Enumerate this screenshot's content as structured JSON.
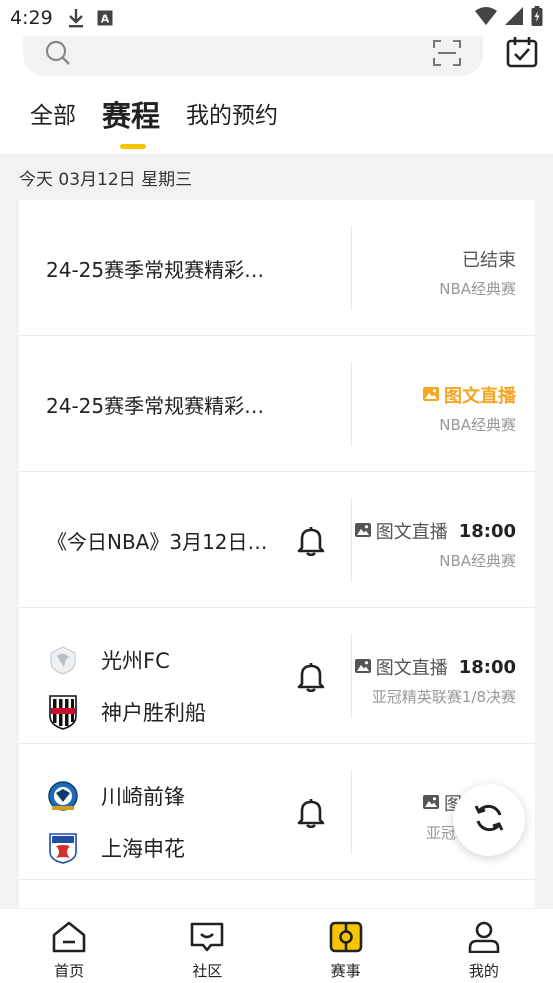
{
  "status_bar": {
    "time": "4:29",
    "icons": [
      "download-icon",
      "a-box-icon",
      "wifi-icon",
      "signal-icon",
      "battery-icon"
    ]
  },
  "search": {
    "placeholder": "",
    "icons": [
      "search-icon",
      "scan-icon",
      "calendar-check-icon"
    ]
  },
  "tabs": [
    {
      "label": "全部",
      "active": false
    },
    {
      "label": "赛程",
      "active": true
    },
    {
      "label": "我的预约",
      "active": false
    }
  ],
  "date_header": "今天 03月12日 星期三",
  "colors": {
    "accent": "#f7c600",
    "live": "#f5a623"
  },
  "rows": [
    {
      "title": "24-25赛季常规赛精彩…",
      "status": "已结束",
      "league": "NBA经典赛"
    },
    {
      "title": "24-25赛季常规赛精彩…",
      "status": "图文直播",
      "league": "NBA经典赛"
    },
    {
      "title": "《今日NBA》3月12日…",
      "status": "图文直播",
      "time": "18:00",
      "league": "NBA经典赛"
    },
    {
      "team1": "光州FC",
      "team2": "神户胜利船",
      "status": "图文直播",
      "time": "18:00",
      "league": "亚冠精英联赛1/8决赛"
    },
    {
      "team1": "川崎前锋",
      "team2": "上海申花",
      "status": "图文直播",
      "league": "亚冠精英联赛"
    }
  ],
  "bottom_nav": [
    {
      "label": "首页",
      "icon": "home-icon"
    },
    {
      "label": "社区",
      "icon": "community-icon"
    },
    {
      "label": "赛事",
      "icon": "match-icon",
      "active": true
    },
    {
      "label": "我的",
      "icon": "profile-icon"
    }
  ]
}
